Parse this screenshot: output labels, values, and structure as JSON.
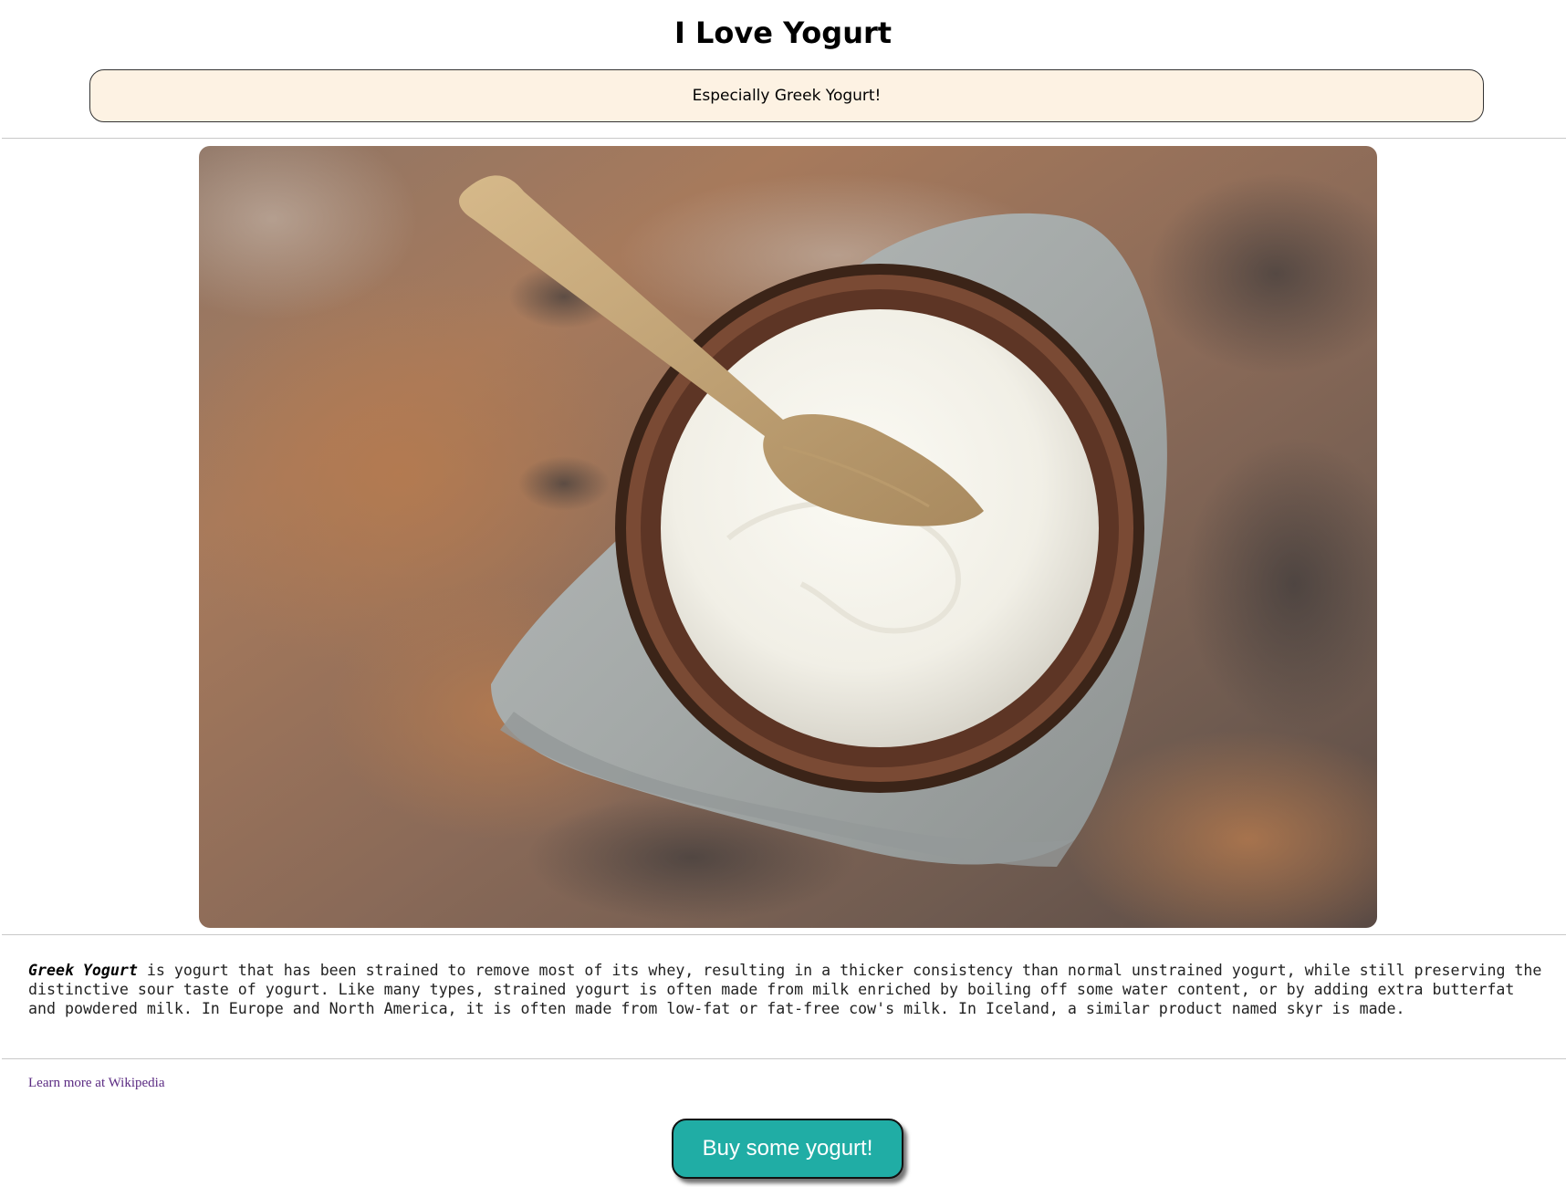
{
  "header": {
    "title": "I Love Yogurt",
    "tagline": "Especially Greek Yogurt!"
  },
  "hero_image": {
    "subject": "bowl-of-greek-yogurt-with-wooden-spoon-on-linen-cloth"
  },
  "description": {
    "term": "Greek Yogurt",
    "text": " is yogurt that has been strained to remove most of its whey, resulting in a thicker consistency than normal unstrained yogurt, while still preserving the distinctive sour taste of yogurt. Like many types, strained yogurt is often made from milk enriched by boiling off some water content, or by adding extra butterfat and powdered milk. In Europe and North America, it is often made from low-fat or fat-free cow's milk. In Iceland, a similar product named skyr is made."
  },
  "links": {
    "wikipedia_label": "Learn more at Wikipedia"
  },
  "actions": {
    "buy_label": "Buy some yogurt!"
  },
  "colors": {
    "banner_background": "#fdf2e3",
    "button_background": "#20ada5",
    "link_color": "#5a2a82"
  }
}
